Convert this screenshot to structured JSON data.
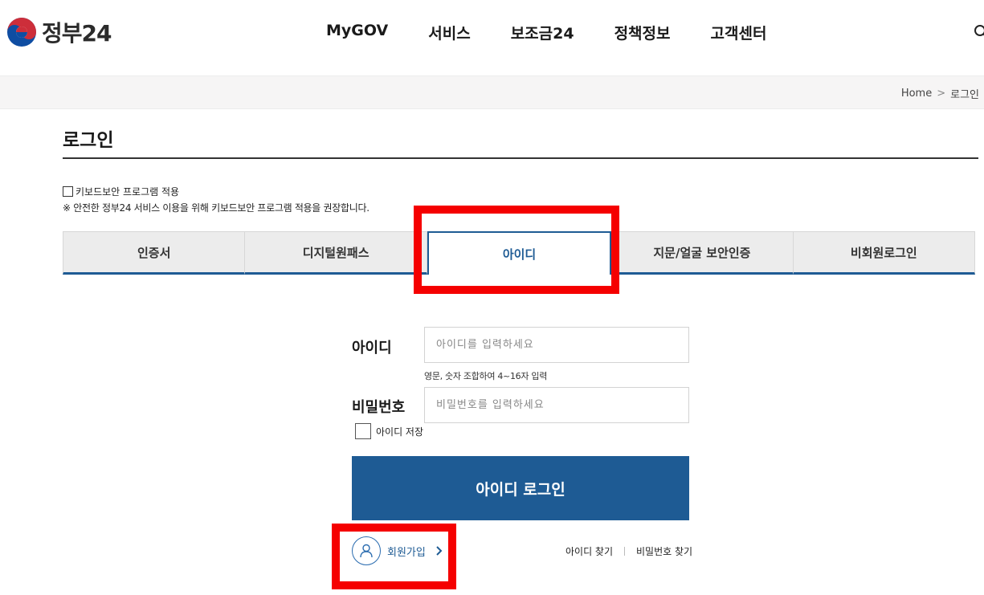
{
  "header": {
    "logo_text": "정부24",
    "nav": [
      "MyGOV",
      "서비스",
      "보조금24",
      "정책정보",
      "고객센터"
    ],
    "icons": {
      "logo": "taegeuk-logo-icon",
      "search": "search-icon"
    }
  },
  "breadcrumb": {
    "home": "Home",
    "separator": ">",
    "current": "로그인"
  },
  "page": {
    "title": "로그인",
    "keyboard_security_label": "키보드보안 프로그램 적용",
    "keyboard_security_note": "※ 안전한 정부24 서비스 이용을 위해 키보드보안 프로그램 적용을 권장합니다."
  },
  "tabs": [
    {
      "label": "인증서",
      "active": false
    },
    {
      "label": "디지털원패스",
      "active": false
    },
    {
      "label": "아이디",
      "active": true
    },
    {
      "label": "지문/얼굴 보안인증",
      "active": false
    },
    {
      "label": "비회원로그인",
      "active": false
    }
  ],
  "form": {
    "id_label": "아이디",
    "id_placeholder": "아이디를 입력하세요",
    "id_value": "",
    "id_hint": "영문, 숫자 조합하여 4~16자 입력",
    "pw_label": "비밀번호",
    "pw_placeholder": "비밀번호를 입력하세요",
    "pw_value": "",
    "save_id_label": "아이디 저장",
    "login_button": "아이디 로그인"
  },
  "links": {
    "signup": "회원가입",
    "find_id": "아이디 찾기",
    "find_pw": "비밀번호 찾기"
  },
  "colors": {
    "primary": "#1e5b94",
    "highlight": "#f50000",
    "logo_red": "#cd2e3a",
    "logo_blue": "#0f4da2"
  }
}
